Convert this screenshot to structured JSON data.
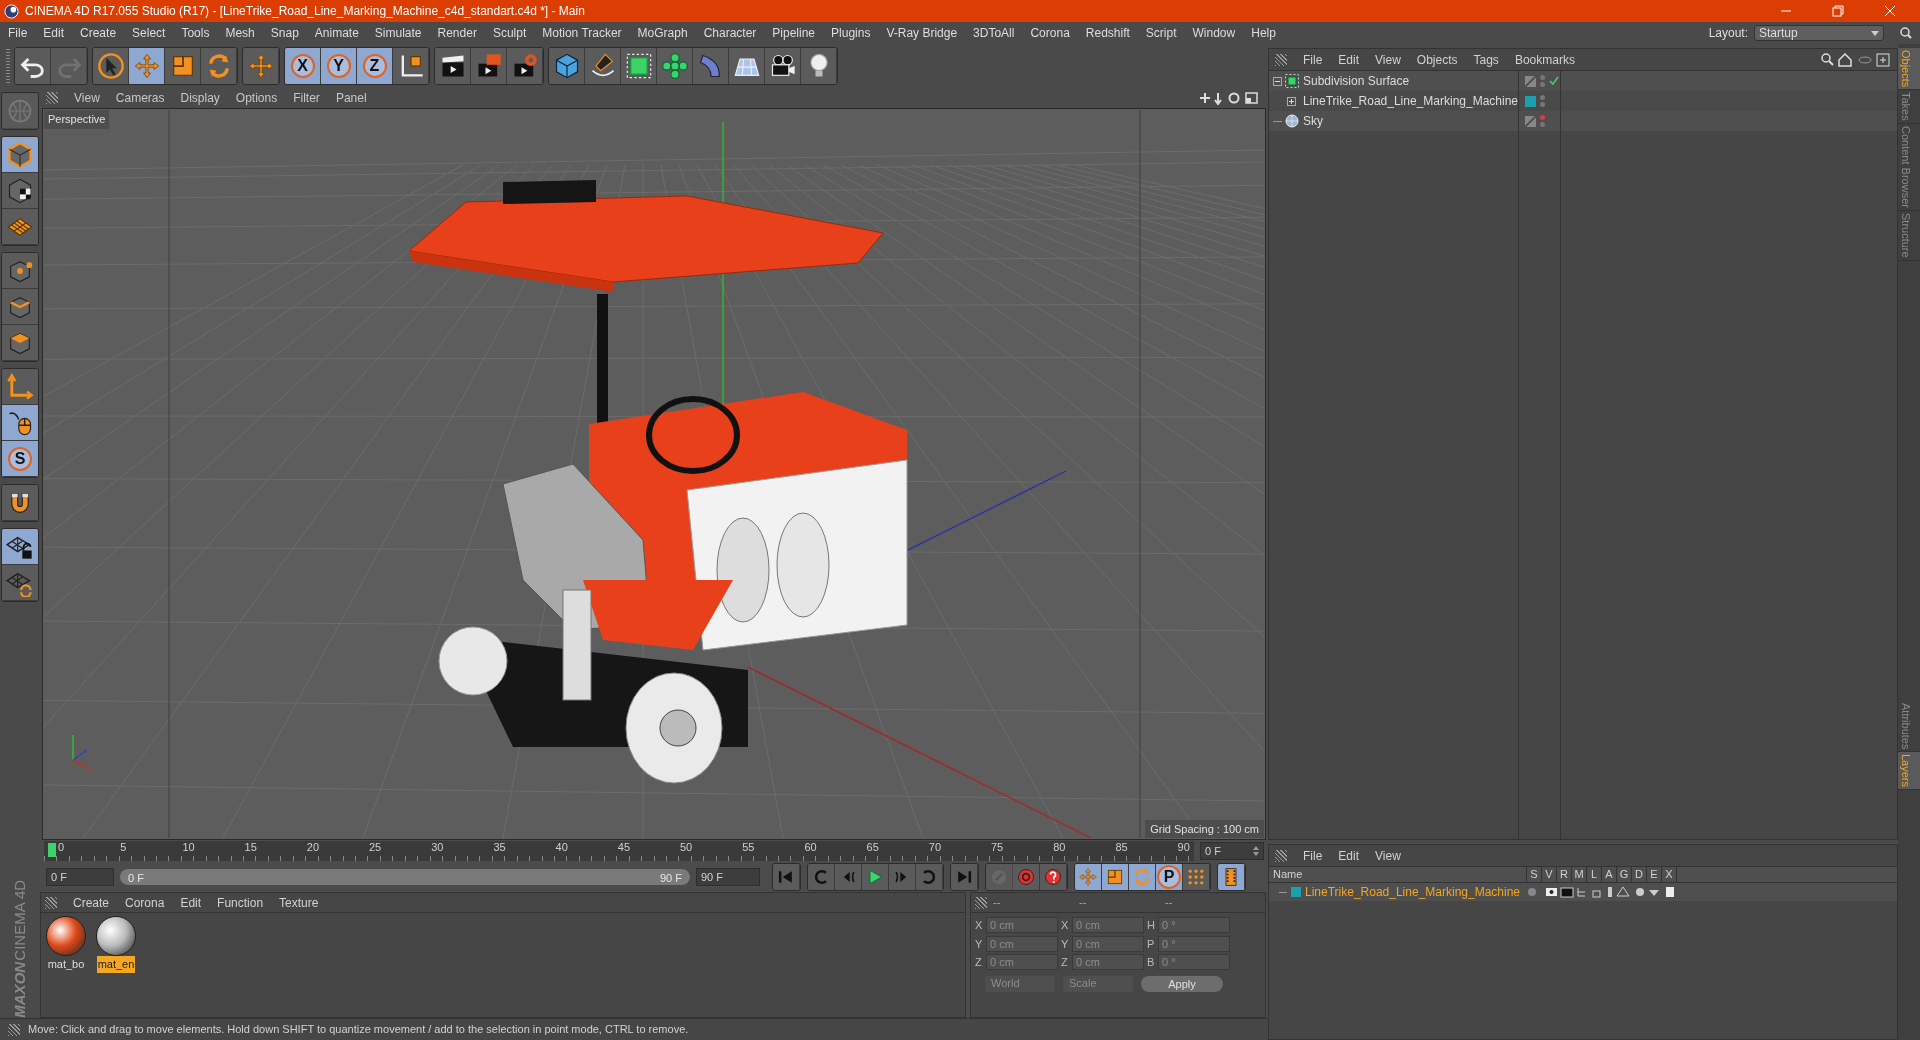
{
  "window": {
    "title": "CINEMA 4D R17.055 Studio (R17) - [LineTrike_Road_Line_Marking_Machine_c4d_standart.c4d *] - Main"
  },
  "menu": [
    "File",
    "Edit",
    "Create",
    "Select",
    "Tools",
    "Mesh",
    "Snap",
    "Animate",
    "Simulate",
    "Render",
    "Sculpt",
    "Motion Tracker",
    "MoGraph",
    "Character",
    "Pipeline",
    "Plugins",
    "V-Ray Bridge",
    "3DToAll",
    "Corona",
    "Redshift",
    "Script",
    "Window",
    "Help"
  ],
  "layout": {
    "label": "Layout:",
    "value": "Startup"
  },
  "toolbar": [
    [
      {
        "kind": "undo",
        "selected": false,
        "disabled": false
      },
      {
        "kind": "redo",
        "selected": false,
        "disabled": true
      }
    ],
    [
      {
        "kind": "select",
        "selected": false,
        "disabled": false
      },
      {
        "kind": "move",
        "selected": true,
        "disabled": false
      },
      {
        "kind": "scale",
        "selected": false,
        "disabled": false
      },
      {
        "kind": "rotate",
        "selected": false,
        "disabled": false
      }
    ],
    [
      {
        "kind": "move",
        "selected": false,
        "disabled": false
      }
    ],
    [
      {
        "kind": "letter",
        "label": "X",
        "selected": true,
        "disabled": false
      },
      {
        "kind": "letter",
        "label": "Y",
        "selected": true,
        "disabled": false
      },
      {
        "kind": "letter",
        "label": "Z",
        "selected": true,
        "disabled": false
      },
      {
        "kind": "coords",
        "selected": false,
        "disabled": false
      }
    ],
    [
      {
        "kind": "render_view",
        "selected": false,
        "disabled": false
      },
      {
        "kind": "render_pv",
        "selected": false,
        "disabled": false
      },
      {
        "kind": "render_settings",
        "selected": false,
        "disabled": false
      }
    ],
    [
      {
        "kind": "cube",
        "selected": false,
        "disabled": false
      },
      {
        "kind": "pen",
        "selected": false,
        "disabled": false
      },
      {
        "kind": "subdiv",
        "selected": false,
        "disabled": false
      },
      {
        "kind": "cloner",
        "selected": false,
        "disabled": false
      },
      {
        "kind": "bend",
        "selected": false,
        "disabled": false
      },
      {
        "kind": "floor",
        "selected": false,
        "disabled": false
      },
      {
        "kind": "camera",
        "selected": false,
        "disabled": false
      },
      {
        "kind": "light",
        "selected": false,
        "disabled": false
      }
    ]
  ],
  "left_toolbar": [
    [
      {
        "kind": "globe",
        "selected": false,
        "disabled": true
      }
    ],
    [
      {
        "kind": "model",
        "selected": true,
        "disabled": false
      },
      {
        "kind": "texture",
        "selected": false,
        "disabled": false
      },
      {
        "kind": "workplane",
        "selected": false,
        "disabled": false
      }
    ],
    [
      {
        "kind": "points",
        "selected": false,
        "disabled": false
      },
      {
        "kind": "edges",
        "selected": false,
        "disabled": false
      },
      {
        "kind": "polygons",
        "selected": false,
        "disabled": false
      }
    ],
    [
      {
        "kind": "axis",
        "selected": false,
        "disabled": false
      },
      {
        "kind": "mouse",
        "selected": true,
        "disabled": false
      },
      {
        "kind": "letter",
        "label": "S",
        "selected": true,
        "disabled": false
      }
    ],
    [
      {
        "kind": "magnet",
        "selected": false,
        "disabled": false
      }
    ],
    [
      {
        "kind": "planelock",
        "selected": true,
        "disabled": false
      },
      {
        "kind": "planealign",
        "selected": false,
        "disabled": false
      }
    ]
  ],
  "viewport": {
    "menu": [
      "View",
      "Cameras",
      "Display",
      "Options",
      "Filter",
      "Panel"
    ],
    "camera": "Perspective",
    "grid_spacing": "Grid Spacing : 100 cm"
  },
  "timeline": {
    "ticks": [
      "0",
      "5",
      "10",
      "15",
      "20",
      "25",
      "30",
      "35",
      "40",
      "45",
      "50",
      "55",
      "60",
      "65",
      "70",
      "75",
      "80",
      "85",
      "90"
    ],
    "current_frame": "0 F",
    "start": "0 F",
    "range_slider": {
      "start": "0 F",
      "end": "90 F",
      "level": 1
    },
    "end": "90 F"
  },
  "playback": [
    [
      {
        "kind": "first",
        "selected": false,
        "disabled": false
      }
    ],
    [
      {
        "kind": "prevkey",
        "selected": false,
        "disabled": false
      },
      {
        "kind": "prevframe",
        "selected": false,
        "disabled": false
      },
      {
        "kind": "play",
        "selected": false,
        "disabled": false
      },
      {
        "kind": "nextframe",
        "selected": false,
        "disabled": false
      },
      {
        "kind": "nextkey",
        "selected": false,
        "disabled": false
      }
    ],
    [
      {
        "kind": "last",
        "selected": false,
        "disabled": false
      }
    ],
    [
      {
        "kind": "keys",
        "selected": false,
        "disabled": true
      },
      {
        "kind": "autokey",
        "selected": false,
        "disabled": false
      },
      {
        "kind": "question",
        "selected": false,
        "disabled": false
      }
    ],
    [
      {
        "kind": "move",
        "selected": true,
        "disabled": false
      },
      {
        "kind": "scale",
        "selected": true,
        "disabled": false
      },
      {
        "kind": "rotate",
        "selected": true,
        "disabled": false
      },
      {
        "kind": "letter",
        "label": "P",
        "selected": true,
        "disabled": false
      },
      {
        "kind": "dots",
        "selected": false,
        "disabled": false
      }
    ],
    [
      {
        "kind": "film",
        "selected": true,
        "disabled": false
      }
    ]
  ],
  "materials": {
    "menu": [
      "Create",
      "Corona",
      "Edit",
      "Function",
      "Texture"
    ],
    "items": [
      {
        "name": "mat_bo",
        "selected": false
      },
      {
        "name": "mat_en",
        "selected": true
      }
    ]
  },
  "coordinates": {
    "headers": [
      "--",
      "--",
      "--"
    ],
    "rows": [
      {
        "position_label": "X",
        "position": "0 cm",
        "size_label": "X",
        "size": "0 cm",
        "rotation_label": "H",
        "rotation": "0 °"
      },
      {
        "position_label": "Y",
        "position": "0 cm",
        "size_label": "Y",
        "size": "0 cm",
        "rotation_label": "P",
        "rotation": "0 °"
      },
      {
        "position_label": "Z",
        "position": "0 cm",
        "size_label": "Z",
        "size": "0 cm",
        "rotation_label": "B",
        "rotation": "0 °"
      }
    ],
    "space": "World",
    "mode": "Scale",
    "apply": "Apply"
  },
  "status_bar": "Move: Click and drag to move elements. Hold down SHIFT to quantize movement / add to the selection in point mode, CTRL to remove.",
  "objects": {
    "menu": [
      "File",
      "Edit",
      "View",
      "Objects",
      "Tags",
      "Bookmarks"
    ],
    "items": [
      {
        "name": "Subdivision Surface",
        "kind": "subdivision",
        "expanded": true,
        "editor_visible": true,
        "enabled": true,
        "children": [
          {
            "name": "LineTrike_Road_Line_Marking_Machine",
            "kind": "null",
            "expanded": false,
            "editor_visible": true,
            "color": "#1aa0ae"
          }
        ]
      },
      {
        "name": "Sky",
        "kind": "sky",
        "editor_visible": false
      }
    ]
  },
  "layers": {
    "menu": [
      "File",
      "Edit",
      "View"
    ],
    "columns": [
      "Name",
      "S",
      "V",
      "R",
      "M",
      "L",
      "A",
      "G",
      "D",
      "E",
      "X"
    ],
    "items": [
      {
        "name": "LineTrike_Road_Line_Marking_Machine",
        "color": "#1aa0ae"
      }
    ]
  },
  "side_tabs_top": [
    {
      "label": "Objects",
      "selected": true
    },
    {
      "label": "Takes",
      "selected": false
    },
    {
      "label": "Content Browser",
      "selected": false
    },
    {
      "label": "Structure",
      "selected": false
    }
  ],
  "side_tabs_bottom": [
    {
      "label": "Attributes",
      "selected": false
    },
    {
      "label": "Layers",
      "selected": true
    }
  ],
  "logo": {
    "brand": "MAXON",
    "product": "CINEMA 4D"
  }
}
